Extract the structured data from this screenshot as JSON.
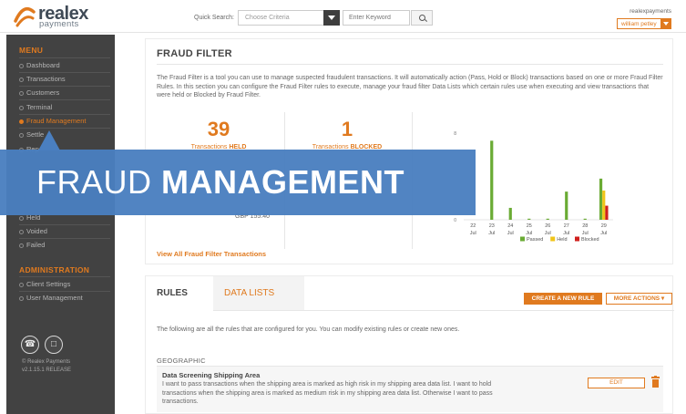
{
  "header": {
    "logo_word": "realex",
    "logo_sub": "payments",
    "quick_search_label": "Quick Search:",
    "criteria_placeholder": "Choose Criteria",
    "keyword_placeholder": "Enter Keyword",
    "user_name": "realexpayments",
    "user_button": "william petley"
  },
  "sidebar": {
    "menu_title": "MENU",
    "items_top": [
      {
        "label": "Dashboard",
        "active": false
      },
      {
        "label": "Transactions",
        "active": false
      },
      {
        "label": "Customers",
        "active": false
      },
      {
        "label": "Terminal",
        "active": false
      },
      {
        "label": "Fraud Management",
        "active": true
      },
      {
        "label": "Settle",
        "active": false
      },
      {
        "label": "Rep",
        "active": false
      }
    ],
    "items_sub": [
      {
        "label": "Held"
      },
      {
        "label": "Voided"
      },
      {
        "label": "Failed"
      }
    ],
    "admin_title": "ADMINISTRATION",
    "admin_items": [
      {
        "label": "Client Settings"
      },
      {
        "label": "User Management"
      }
    ],
    "icons": [
      "phone-icon",
      "chat-icon"
    ],
    "footer_line1": "© Realex Payments",
    "footer_line2": "v2.1.15.1 RELEASE"
  },
  "fraud_filter": {
    "title": "FRAUD FILTER",
    "description": "The Fraud Filter is a tool you can use to manage suspected fraudulent transactions. It will automatically action (Pass, Hold or Block) transactions based on one or more Fraud Filter Rules. In this section you can configure the Fraud Filter rules to execute, manage your fraud filter Data Lists which certain rules use when executing and view transactions that were held or Blocked by Fraud Filter.",
    "held_count": "39",
    "held_label_pre": "Transactions ",
    "held_label_bold": "HELD",
    "blocked_count": "1",
    "blocked_label_pre": "Transactions ",
    "blocked_label_bold": "BLOCKED",
    "currency_value": "GBP 155.40",
    "view_link": "View All Fraud Filter Transactions"
  },
  "chart_data": {
    "type": "bar",
    "categories": [
      "22 Jul",
      "23 Jul",
      "24 Jul",
      "25 Jul",
      "26 Jul",
      "27 Jul",
      "28 Jul",
      "29 Jul"
    ],
    "category_day": [
      "22",
      "23",
      "24",
      "25",
      "26",
      "27",
      "28",
      "29"
    ],
    "category_month": [
      "Jul",
      "Jul",
      "Jul",
      "Jul",
      "Jul",
      "Jul",
      "Jul",
      "Jul"
    ],
    "yticks": [
      "0",
      "8"
    ],
    "ylim": [
      0,
      8
    ],
    "series": [
      {
        "name": "Passed",
        "color": "#6aab34",
        "values": [
          0,
          7.3,
          1.1,
          0.1,
          0.1,
          2.6,
          0.1,
          3.8
        ]
      },
      {
        "name": "Held",
        "color": "#f0c419",
        "values": [
          0,
          0,
          0,
          0,
          0,
          0,
          0,
          2.7
        ]
      },
      {
        "name": "Blocked",
        "color": "#d0201e",
        "values": [
          0,
          0,
          0,
          0,
          0,
          0,
          0,
          1.3
        ]
      }
    ],
    "legend_position": "bottom-right"
  },
  "banner": {
    "word1": "FRAUD",
    "word2": "MANAGEMENT"
  },
  "rules": {
    "tab_rules": "RULES",
    "tab_lists": "DATA LISTS",
    "create_button": "CREATE A NEW RULE",
    "more_button": "MORE ACTIONS ▾",
    "description": "The following are all the rules that are configured for you. You can modify existing rules or create new ones.",
    "group_heading": "GEOGRAPHIC",
    "rule_title": "Data Screening Shipping Area",
    "rule_text": "I want to pass transactions when the shipping area is marked as high risk in my shipping area data list. I want to hold transactions when the shipping area is marked as medium risk in my shipping area data list. Otherwise I want to pass transactions.",
    "edit_button": "EDIT"
  }
}
